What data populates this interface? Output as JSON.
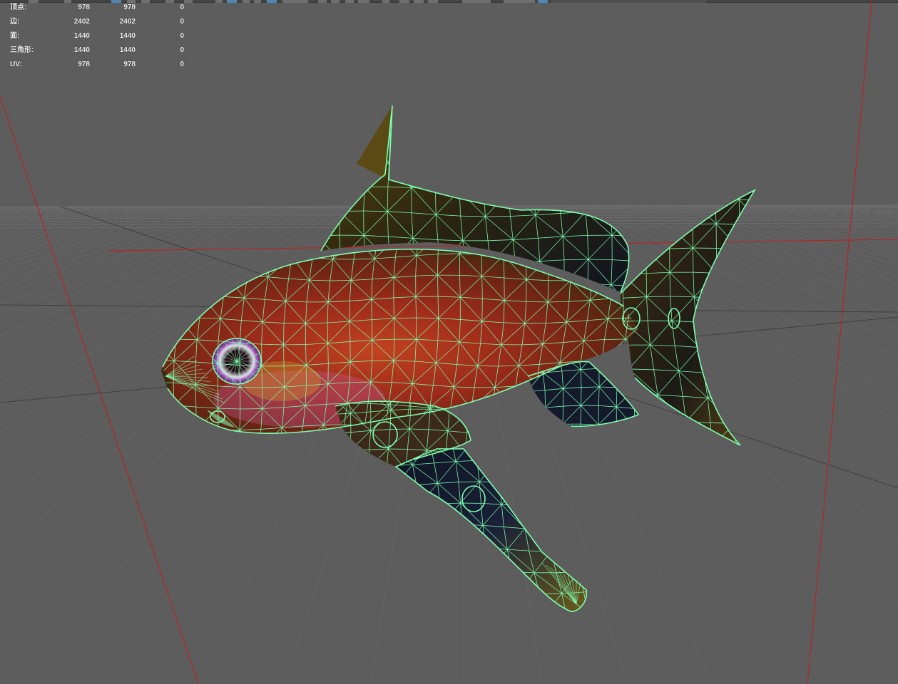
{
  "colors": {
    "viewport_bg": "#5d5d5d",
    "grid_line": "#6e6e6e",
    "grid_major": "#3f3f3f",
    "axis_red": "#c81a1a",
    "wireframe": "#7dffb0",
    "hud_text": "#f2f2f2",
    "toolbar_active": "#4f86b3"
  },
  "hud": {
    "rows": [
      {
        "label": "顶点:",
        "c1": "978",
        "c2": "978",
        "c3": "0"
      },
      {
        "label": "边:",
        "c1": "2402",
        "c2": "2402",
        "c3": "0"
      },
      {
        "label": "面:",
        "c1": "1440",
        "c2": "1440",
        "c3": "0"
      },
      {
        "label": "三角形:",
        "c1": "1440",
        "c2": "1440",
        "c3": "0"
      },
      {
        "label": "UV:",
        "c1": "978",
        "c2": "978",
        "c3": "0"
      }
    ]
  },
  "scene": {
    "model": "fish-wireframe-on-shaded",
    "view": "perspective"
  }
}
